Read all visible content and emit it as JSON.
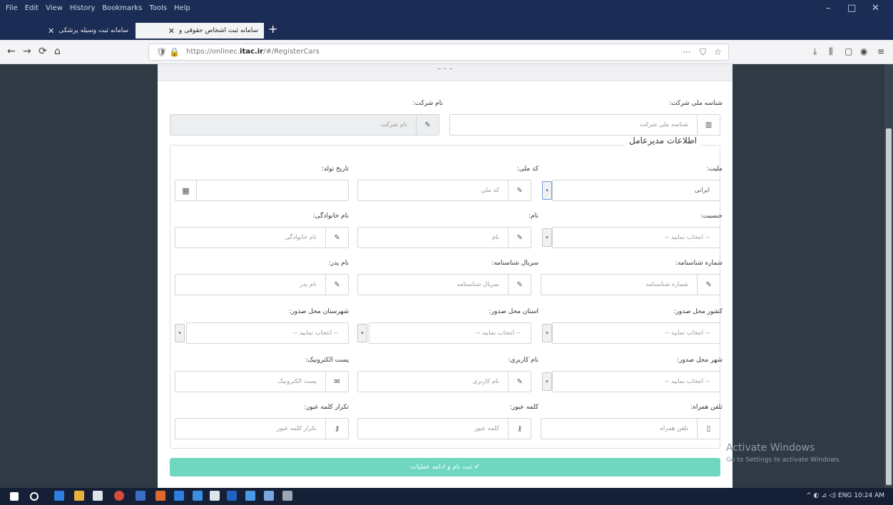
{
  "browser": {
    "menu": [
      "File",
      "Edit",
      "View",
      "History",
      "Bookmarks",
      "Tools",
      "Help"
    ],
    "window_controls": [
      "–",
      "□",
      "✕"
    ],
    "tabs": [
      {
        "label": "سامانه ثبت وسیله پرشکی",
        "close": "✕"
      },
      {
        "label": "سامانه ثبت اشخاص حقوقی و",
        "close": "✕"
      }
    ],
    "new_tab": "+",
    "nav": {
      "back": "←",
      "forward": "→",
      "reload": "⟳",
      "home": "⌂"
    },
    "url": {
      "pre": "https://onlinec.",
      "domain": "itac.ir",
      "post": "/#/RegisterCars"
    },
    "url_icons": {
      "shield": "🛡",
      "lock": "🔒",
      "more": "···",
      "pocket": "⛉",
      "star": "☆"
    },
    "toolbar_icons": [
      "⤓",
      "⫼",
      "▢",
      "◉",
      "≡"
    ]
  },
  "form": {
    "card_header": "– – –",
    "company_id_label": "شناسه ملی شرکت:",
    "company_id_placeholder": "شناسه ملی شرکت",
    "company_name_label": "نام شرکت:",
    "company_name_placeholder": "نام شرکت",
    "section_title": "اطلاعات مدیرعامل",
    "fields": {
      "nationality": {
        "label": "ملیت:",
        "value": "ایرانی"
      },
      "national_code": {
        "label": "کد ملی:",
        "placeholder": "کد ملی"
      },
      "birth_date": {
        "label": "تاریخ تولد:"
      },
      "gender": {
        "label": "جنسیت:",
        "value": "-- انتخاب نمایید --"
      },
      "first_name": {
        "label": "نام:",
        "placeholder": "نام"
      },
      "last_name": {
        "label": "نام خانوادگی:",
        "placeholder": "نام خانوادگی"
      },
      "id_number": {
        "label": "شماره شناسنامه:",
        "placeholder": "شماره شناسنامه"
      },
      "id_serial": {
        "label": "سریال شناسنامه:",
        "placeholder": "سریال شناسنامه"
      },
      "father_name": {
        "label": "نام پدر:",
        "placeholder": "نام پدر"
      },
      "issue_country": {
        "label": "کشور محل صدور:",
        "value": "-- انتخاب نمایید --"
      },
      "issue_province": {
        "label": "استان محل صدور:",
        "value": "-- انتخاب نمایید --"
      },
      "issue_county": {
        "label": "شهرستان محل صدور:",
        "value": "-- انتخاب نمایید --"
      },
      "issue_city": {
        "label": "شهر محل صدور:",
        "value": "-- انتخاب نمایید --"
      },
      "username": {
        "label": "نام کاربری:",
        "placeholder": "نام کاربری"
      },
      "email": {
        "label": "پست الکترونیک:",
        "placeholder": "پست الکترونیک"
      },
      "mobile": {
        "label": "تلفن همراه:",
        "placeholder": "تلفن همراه"
      },
      "password": {
        "label": "کلمه عبور:",
        "placeholder": "کلمه عبور"
      },
      "password_confirm": {
        "label": "تکرار کلمه عبور:",
        "placeholder": "تکرار کلمه عبور"
      }
    },
    "submit_label": "✔ ثبت نام و ادامه عملیات"
  },
  "watermark": {
    "line1": "Activate Windows",
    "line2": "Go to Settings to activate Windows."
  },
  "taskbar": {
    "tray": "^  ◐  ⊿  ◁)  ENG   10:24 AM"
  },
  "colors": {
    "accent": "#6fd7c0",
    "titlebar": "#1c2d55",
    "page_bg": "#2f3a44"
  }
}
